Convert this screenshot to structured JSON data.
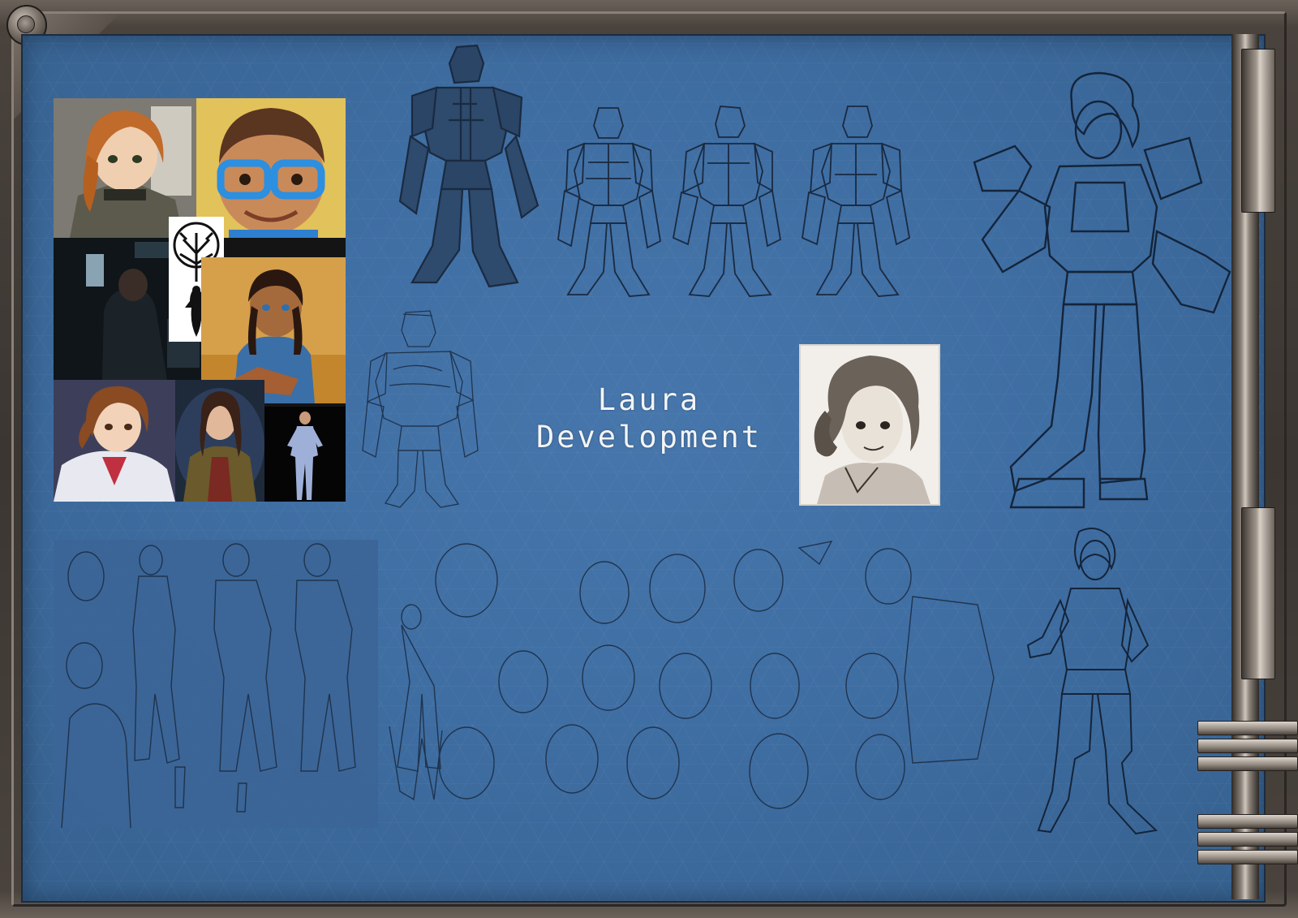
{
  "title": {
    "line1": "Laura",
    "line2": "Development"
  },
  "colors": {
    "board": "#3f6ea3",
    "frame": "#4a433d",
    "sketch_line": "#1a2a40",
    "title_text": "#f2f4f6"
  },
  "reference_collage": {
    "tiles": [
      {
        "name": "anime-pilot-redhead-image"
      },
      {
        "name": "puppet-boy-blue-glasses-image"
      },
      {
        "name": "tree-symbol-logo"
      },
      {
        "name": "cockpit-silhouette-image"
      },
      {
        "name": "warrior-girl-blue-image"
      },
      {
        "name": "anime-brown-hair-uniform-image"
      },
      {
        "name": "actress-jacket-image"
      },
      {
        "name": "jumpsuit-mechanic-image"
      }
    ]
  },
  "sketches": {
    "armor_front_large": "armor-suit-sketch",
    "armor_turnaround": [
      "armor-turnaround-front",
      "armor-turnaround-three-quarter",
      "armor-turnaround-back"
    ],
    "armor_rough": "armor-rough-sketch",
    "laura_in_armor": "laura-armored-lineart",
    "laura_casual": "laura-casual-lineart",
    "face_studies": "face-study-sheet",
    "body_studies": "body-study-sheet"
  }
}
